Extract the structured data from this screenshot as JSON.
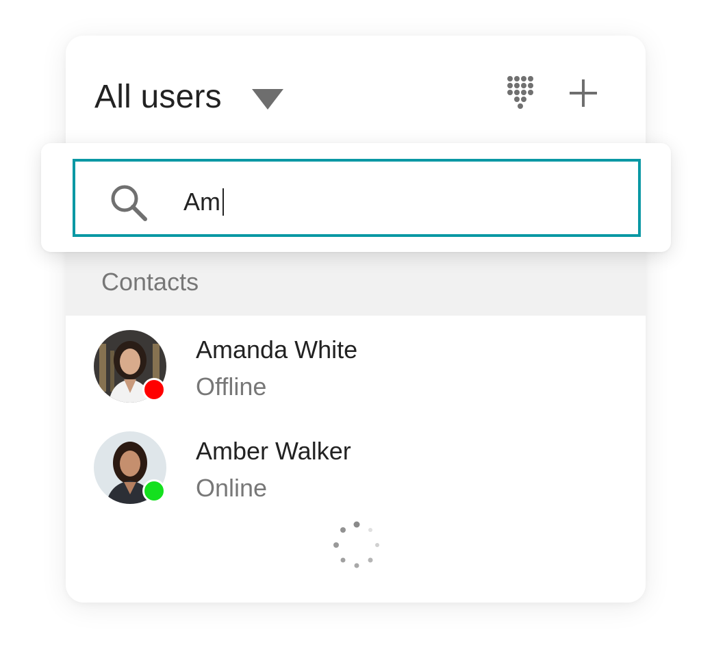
{
  "header": {
    "title": "All users",
    "dropdown_icon": "caret-down-icon",
    "dialpad_icon": "dialpad-icon",
    "add_icon": "plus-icon"
  },
  "search": {
    "value": "Am",
    "icon": "search-icon",
    "border_color": "#0a98a4"
  },
  "contacts": {
    "section_label": "Contacts",
    "items": [
      {
        "name": "Amanda White",
        "status": "Offline",
        "status_color": "#ff0000"
      },
      {
        "name": "Amber Walker",
        "status": "Online",
        "status_color": "#14e01e"
      }
    ]
  },
  "loading": {
    "icon": "loading-spinner-icon"
  }
}
